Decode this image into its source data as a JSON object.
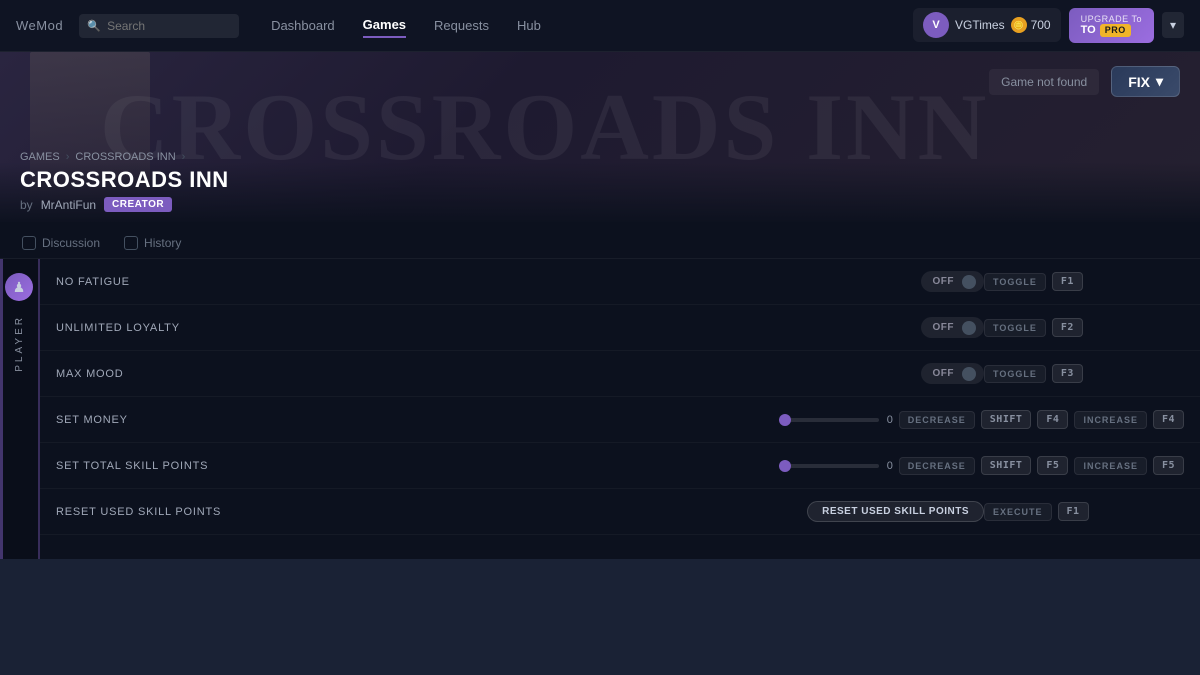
{
  "app": {
    "title": "WeMod"
  },
  "topbar": {
    "logo": "wemod",
    "search_placeholder": "Search",
    "nav_items": [
      {
        "id": "dashboard",
        "label": "Dashboard",
        "active": false
      },
      {
        "id": "games",
        "label": "Games",
        "active": true
      },
      {
        "id": "requests",
        "label": "Requests",
        "active": false
      },
      {
        "id": "hub",
        "label": "Hub",
        "active": false
      }
    ],
    "user": {
      "initials": "V",
      "name": "VGTimes",
      "coins": "700",
      "coin_icon": "🪙"
    },
    "upgrade": {
      "top_label": "UPGRADE To",
      "to_label": "TO",
      "pro_label": "PRO"
    },
    "chevron": "▾"
  },
  "breadcrumb": {
    "items": [
      {
        "label": "GAMES"
      },
      {
        "label": "CROSSROADS INN"
      }
    ],
    "separator": "›"
  },
  "game": {
    "title": "CROSSROADS INN",
    "author": "MrAntiFun",
    "author_prefix": "by",
    "creator_badge": "CREATOR",
    "not_found_text": "Game not found",
    "fix_btn_label": "FIX",
    "fix_chevron": "▾",
    "hero_text": "CROSSROADS",
    "hero_text2": "INN"
  },
  "tabs": [
    {
      "id": "discussion",
      "label": "Discussion",
      "active": false
    },
    {
      "id": "history",
      "label": "History",
      "active": false
    }
  ],
  "player_section": {
    "label": "PLAYER",
    "icon": "♟"
  },
  "cheats": [
    {
      "id": "no-fatigue",
      "name": "NO FATIGUE",
      "type": "toggle",
      "toggle_state": "OFF",
      "keybind_action": "TOGGLE",
      "keybind_key": "F1"
    },
    {
      "id": "unlimited-loyalty",
      "name": "UNLIMITED LOYALTY",
      "type": "toggle",
      "toggle_state": "OFF",
      "keybind_action": "TOGGLE",
      "keybind_key": "F2"
    },
    {
      "id": "max-mood",
      "name": "MAX MOOD",
      "type": "toggle",
      "toggle_state": "OFF",
      "keybind_action": "TOGGLE",
      "keybind_key": "F3"
    },
    {
      "id": "set-money",
      "name": "SET MONEY",
      "type": "slider",
      "slider_value": "0",
      "keybind_decrease": "DECREASE",
      "keybind_shift": "SHIFT",
      "keybind_key_decrease": "F4",
      "keybind_increase": "INCREASE",
      "keybind_key_increase": "F4"
    },
    {
      "id": "set-total-skill-points",
      "name": "SET TOTAL SKILL POINTS",
      "type": "slider",
      "slider_value": "0",
      "keybind_decrease": "DECREASE",
      "keybind_shift": "SHIFT",
      "keybind_key_decrease": "F5",
      "keybind_increase": "INCREASE",
      "keybind_key_increase": "F5"
    },
    {
      "id": "reset-used-skill-points",
      "name": "RESET USED SKILL POINTS",
      "type": "button",
      "button_label": "RESET USED SKILL POINTS",
      "keybind_action": "EXECUTE",
      "keybind_key": "F1"
    }
  ]
}
